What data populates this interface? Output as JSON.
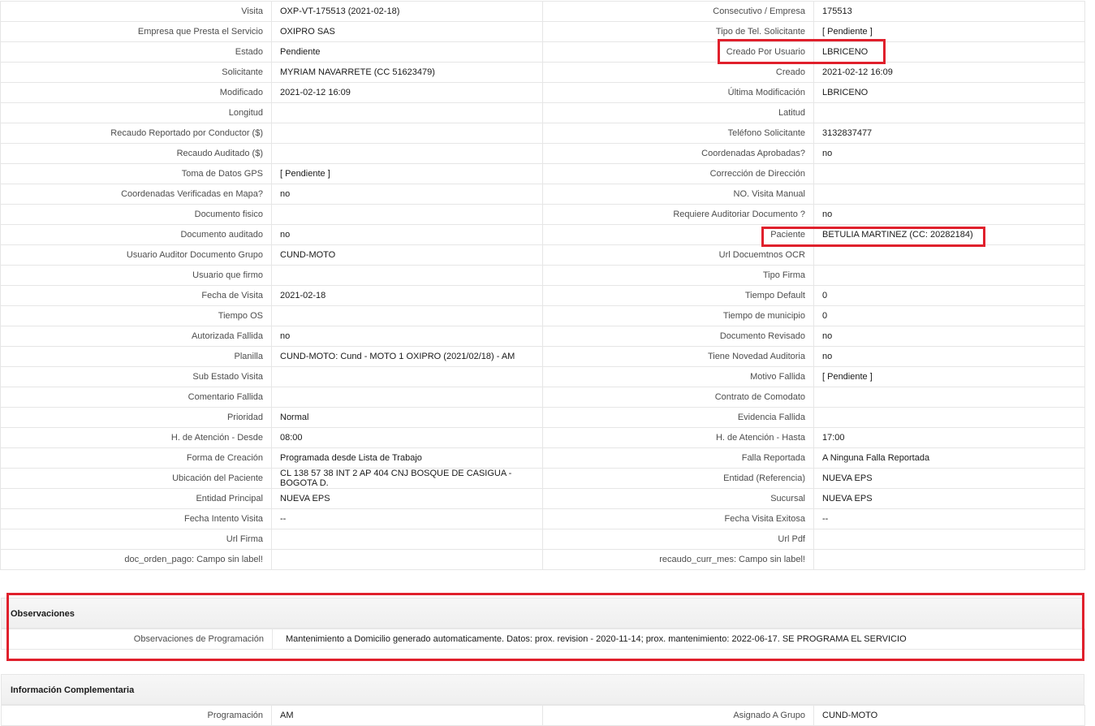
{
  "colors": {
    "highlight": "#e0202c",
    "border": "#e6e6e6"
  },
  "rows": [
    {
      "l1": "Visita",
      "v1": "OXP-VT-175513 (2021-02-18)",
      "l2": "Consecutivo / Empresa",
      "v2": "175513"
    },
    {
      "l1": "Empresa que Presta el Servicio",
      "v1": "OXIPRO SAS",
      "l2": "Tipo de Tel. Solicitante",
      "v2": "[ Pendiente ]"
    },
    {
      "l1": "Estado",
      "v1": "Pendiente",
      "l2": "Creado Por Usuario",
      "v2": "LBRICENO"
    },
    {
      "l1": "Solicitante",
      "v1": "MYRIAM NAVARRETE (CC 51623479)",
      "l2": "Creado",
      "v2": "2021-02-12 16:09"
    },
    {
      "l1": "Modificado",
      "v1": "2021-02-12 16:09",
      "l2": "Última Modificación",
      "v2": " LBRICENO"
    },
    {
      "l1": "Longitud",
      "v1": "",
      "l2": "Latitud",
      "v2": ""
    },
    {
      "l1": "Recaudo Reportado por Conductor ($)",
      "v1": "",
      "l2": "Teléfono Solicitante",
      "v2": "3132837477"
    },
    {
      "l1": "Recaudo Auditado ($)",
      "v1": "",
      "l2": "Coordenadas Aprobadas?",
      "v2": " no"
    },
    {
      "l1": "Toma de Datos GPS",
      "v1": "[ Pendiente ]",
      "l2": "Corrección de Dirección",
      "v2": ""
    },
    {
      "l1": "Coordenadas Verificadas en Mapa?",
      "v1": " no",
      "l2": "NO. Visita Manual",
      "v2": ""
    },
    {
      "l1": "Documento fisico",
      "v1": "",
      "l2": "Requiere Auditoriar Documento ?",
      "v2": " no"
    },
    {
      "l1": "Documento auditado",
      "v1": " no",
      "l2": "Paciente",
      "v2": "BETULIA MARTINEZ (CC: 20282184)"
    },
    {
      "l1": "Usuario Auditor Documento Grupo",
      "v1": "CUND-MOTO",
      "l2": "Url Docuemtnos OCR",
      "v2": ""
    },
    {
      "l1": "Usuario que firmo",
      "v1": "",
      "l2": "Tipo Firma",
      "v2": ""
    },
    {
      "l1": "Fecha de Visita",
      "v1": " 2021-02-18",
      "l2": "Tiempo Default",
      "v2": "0"
    },
    {
      "l1": "Tiempo OS",
      "v1": "",
      "l2": "Tiempo de municipio",
      "v2": "0"
    },
    {
      "l1": "Autorizada Fallida",
      "v1": " no",
      "l2": "Documento Revisado",
      "v2": " no"
    },
    {
      "l1": "Planilla",
      "v1": "CUND-MOTO: Cund - MOTO 1 OXIPRO (2021/02/18) - AM",
      "l2": "Tiene Novedad Auditoria",
      "v2": " no"
    },
    {
      "l1": "Sub Estado Visita",
      "v1": "",
      "l2": "Motivo Fallida",
      "v2": "[ Pendiente ]"
    },
    {
      "l1": "Comentario Fallida",
      "v1": "",
      "l2": "Contrato de Comodato",
      "v2": ""
    },
    {
      "l1": "Prioridad",
      "v1": "Normal",
      "l2": "Evidencia Fallida",
      "v2": ""
    },
    {
      "l1": "H. de Atención - Desde",
      "v1": "08:00",
      "l2": "H. de Atención - Hasta",
      "v2": "17:00"
    },
    {
      "l1": "Forma de Creación",
      "v1": "Programada desde Lista de Trabajo",
      "l2": "Falla Reportada",
      "v2": "A Ninguna Falla Reportada"
    },
    {
      "l1": "Ubicación del Paciente",
      "v1": "CL 138 57 38 INT 2 AP 404 CNJ BOSQUE DE CASIGUA - BOGOTA D.",
      "l2": "Entidad (Referencia)",
      "v2": "NUEVA EPS"
    },
    {
      "l1": "Entidad Principal",
      "v1": "NUEVA EPS",
      "l2": "Sucursal",
      "v2": "NUEVA EPS"
    },
    {
      "l1": "Fecha Intento Visita",
      "v1": " --",
      "l2": "Fecha Visita Exitosa",
      "v2": " --"
    },
    {
      "l1": "Url Firma",
      "v1": "",
      "l2": "Url Pdf",
      "v2": ""
    },
    {
      "l1": "doc_orden_pago: Campo sin label!",
      "v1": "",
      "l2": "recaudo_curr_mes: Campo sin label!",
      "v2": ""
    }
  ],
  "observaciones": {
    "title": "Observaciones",
    "label": "Observaciones de Programación",
    "value": "Mantenimiento a Domicilio generado automaticamente. Datos: prox. revision - 2020-11-14; prox. mantenimiento: 2022-06-17. SE PROGRAMA EL SERVICIO"
  },
  "info": {
    "title": "Información Complementaria",
    "row": {
      "l1": "Programación",
      "v1": "AM",
      "l2": "Asignado A Grupo",
      "v2": "CUND-MOTO"
    }
  }
}
